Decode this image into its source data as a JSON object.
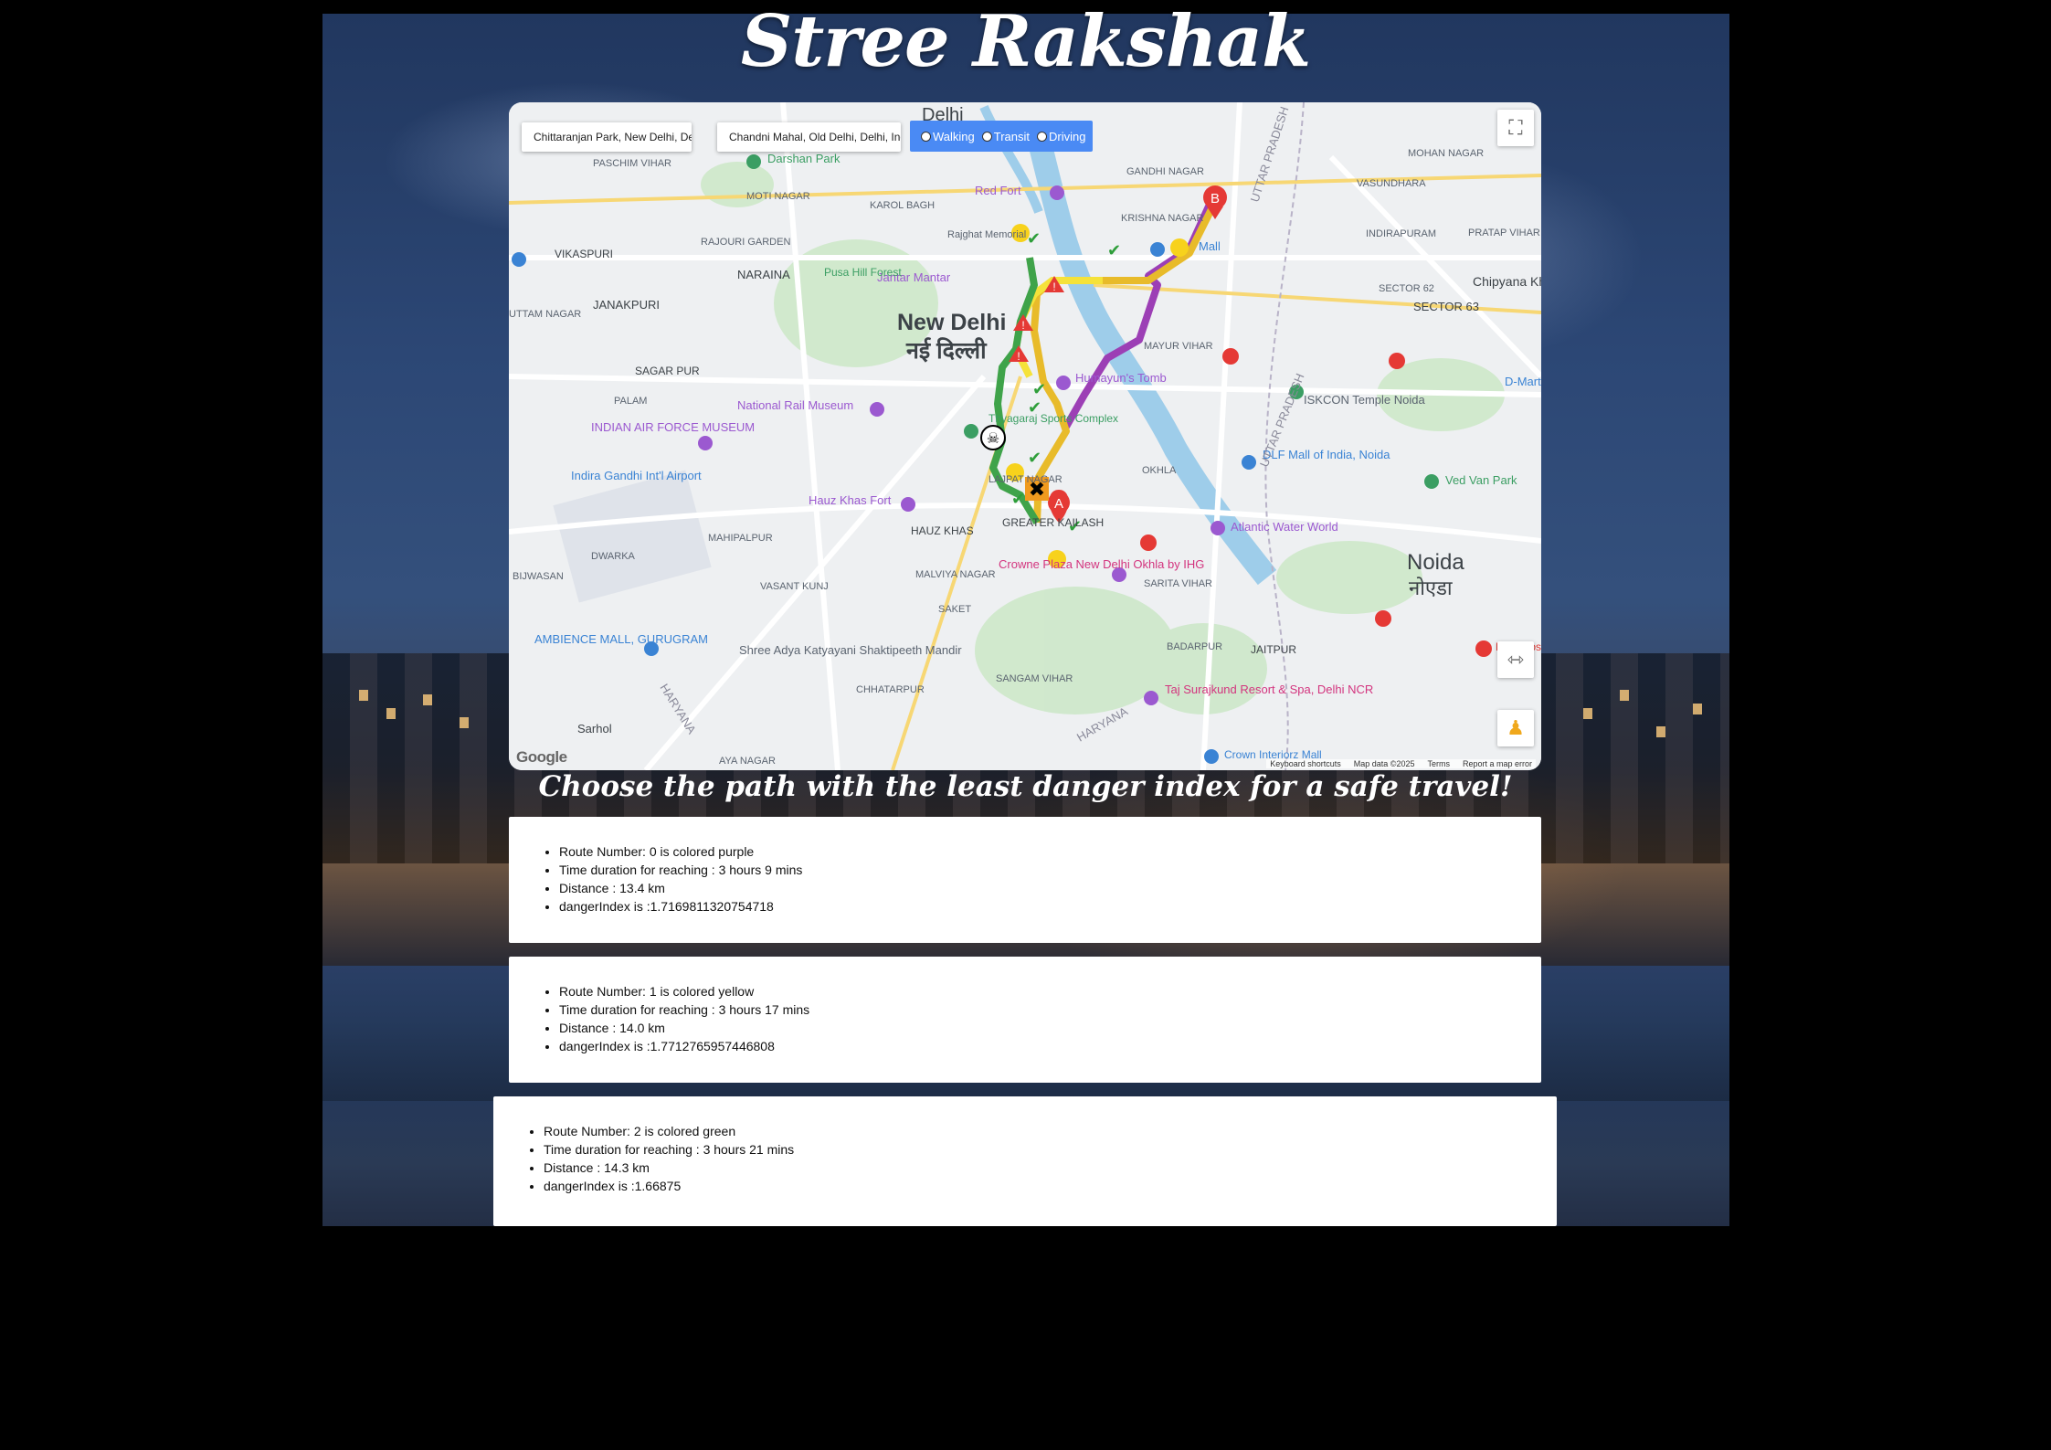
{
  "app": {
    "title": "Stree Rakshak"
  },
  "map": {
    "origin_value": "Chittaranjan Park, New Delhi, Delhi, India",
    "destination_value": "Chandni Mahal, Old Delhi, Delhi, India",
    "modes": [
      "Walking",
      "Transit",
      "Driving"
    ],
    "selected_mode": "Walking",
    "attribution": {
      "shortcuts": "Keyboard shortcuts",
      "data": "Map data ©2025",
      "terms": "Terms",
      "report": "Report a map error"
    },
    "logo": "Google",
    "labels": {
      "city": "New Delhi",
      "city_hi": "नई दिल्ली",
      "noida": "Noida",
      "noida_hi": "नोएडा",
      "delhi": "Delhi",
      "pashchim_vihar": "PASCHIM VIHAR",
      "darshan_park": "Darshan Park",
      "red_fort": "Red Fort",
      "gandhi_nagar": "GANDHI NAGAR",
      "mohan_nagar": "MOHAN NAGAR",
      "vasundhara": "VASUNDHARA",
      "indirapuram": "INDIRAPURAM",
      "pratap_vihar": "PRATAP VIHAR",
      "chipyana": "Chipyana Khurd Urf Tigri",
      "sector62": "SECTOR 62",
      "sector63": "SECTOR 63",
      "vikaspuri": "VIKASPURI",
      "janakpuri": "JANAKPURI",
      "naraina": "NARAINA",
      "jantar_mantar": "Jantar Mantar",
      "pusa_hill": "Pusa Hill Forest",
      "sagar_pur": "SAGAR PUR",
      "rail_museum": "National Rail Museum",
      "humayun": "Humayun's Tomb",
      "iskcon": "ISKCON Temple Noida",
      "air_force": "INDIAN AIR FORCE MUSEUM",
      "airport": "Indira Gandhi Int'l Airport",
      "dlf_mall": "DLF Mall of India, Noida",
      "ved_van": "Ved Van Park",
      "hauz_khas_fort": "Hauz Khas Fort",
      "hauz_khas": "HAUZ KHAS",
      "crowne": "Crowne Plaza New Delhi Okhla by IHG",
      "atlantic": "Atlantic Water World",
      "mahipalpur": "MAHIPALPUR",
      "vasant_kunj": "VASANT KUNJ",
      "malviya": "MALVIYA NAGAR",
      "saket": "SAKET",
      "sarita": "SARITA VIHAR",
      "ambience": "AMBIENCE MALL, GURUGRAM",
      "shree_adya": "Shree Adya Katyayani Shaktipeeth Mandir",
      "chhatarpur": "CHHATARPUR",
      "sangam": "SANGAM VIHAR",
      "badarpur": "BADARPUR",
      "jaitpur": "JAITPUR",
      "taj": "Taj Surajkund Resort & Spa, Delhi NCR",
      "sahol": "Sarhol",
      "crown_mall": "Crown Interiorz Mall",
      "aya_nagar": "AYA NAGAR",
      "uttar_pradesh": "UTTAR PRADESH",
      "haryana": "HARYANA",
      "bijwasan": "BIJWASAN",
      "palam": "PALAM",
      "rajouri": "RAJOURI GARDEN",
      "moti_nagar": "MOTI NAGAR",
      "karol_bagh": "KAROL BAGH",
      "krishna_nagar": "KRISHNA NAGAR",
      "okhla": "OKHLA",
      "great_kailash": "GREATER KAILASH",
      "uttam_nagar": "UTTAM NAGAR",
      "dwarka": "DWARKA",
      "rajghat": "Rajghat Memorial",
      "mayur_vihar": "MAYUR VIHAR",
      "mall": "Mall",
      "pragati": "Thyagaraj Sports Complex",
      "lajpat": "LAJPAT NAGAR",
      "dmart": "D-Mart",
      "felix": "Felix Hosp"
    },
    "markers": {
      "start": "A",
      "end": "B"
    },
    "route_colors": {
      "purple": "#9c3fb5",
      "yellow": "#f5e23a",
      "green": "#3fa34a",
      "gold": "#e8bb2a"
    }
  },
  "subtitle": "Choose the path with the least danger index for a safe travel!",
  "routes": [
    {
      "number_line": "Route Number: 0 is colored purple",
      "time_line": "Time duration for reaching : 3 hours 9 mins",
      "distance_line": "Distance : 13.4 km",
      "danger_line": "dangerIndex is :1.7169811320754718"
    },
    {
      "number_line": "Route Number: 1 is colored yellow",
      "time_line": "Time duration for reaching : 3 hours 17 mins",
      "distance_line": "Distance : 14.0 km",
      "danger_line": "dangerIndex is :1.7712765957446808"
    },
    {
      "number_line": "Route Number: 2 is colored green",
      "time_line": "Time duration for reaching : 3 hours 21 mins",
      "distance_line": "Distance : 14.3 km",
      "danger_line": "dangerIndex is :1.66875"
    }
  ]
}
